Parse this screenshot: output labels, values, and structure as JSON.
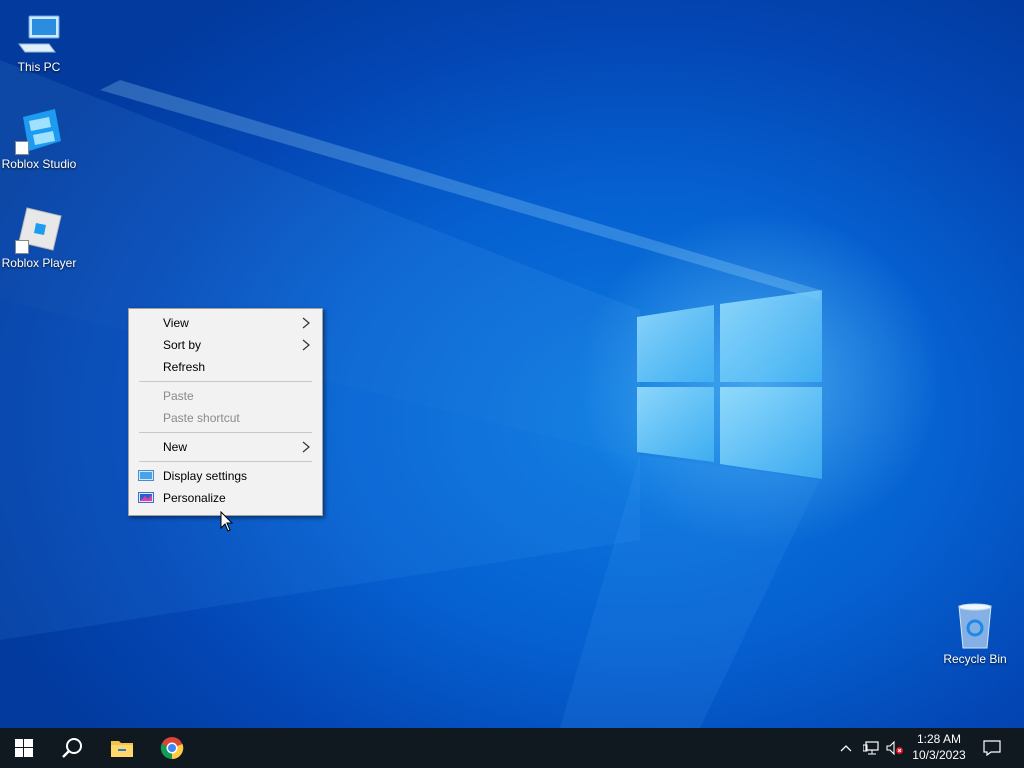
{
  "desktop": {
    "icons": [
      {
        "label": "This PC",
        "icon": "this-pc-icon"
      },
      {
        "label": "Roblox Studio",
        "icon": "roblox-studio-icon"
      },
      {
        "label": "Roblox Player",
        "icon": "roblox-player-icon"
      },
      {
        "label": "Recycle Bin",
        "icon": "recycle-bin-icon"
      }
    ]
  },
  "context_menu": {
    "items": [
      {
        "label": "View",
        "has_submenu": true,
        "enabled": true
      },
      {
        "label": "Sort by",
        "has_submenu": true,
        "enabled": true
      },
      {
        "label": "Refresh",
        "has_submenu": false,
        "enabled": true
      },
      {
        "label": "Paste",
        "has_submenu": false,
        "enabled": false
      },
      {
        "label": "Paste shortcut",
        "has_submenu": false,
        "enabled": false
      },
      {
        "label": "New",
        "has_submenu": true,
        "enabled": true
      },
      {
        "label": "Display settings",
        "icon": "display-settings-icon",
        "enabled": true
      },
      {
        "label": "Personalize",
        "icon": "personalize-icon",
        "enabled": true
      }
    ]
  },
  "taskbar": {
    "pinned": [
      "start-icon",
      "search-icon",
      "file-explorer-icon",
      "chrome-icon"
    ],
    "tray_icons": [
      "chevron-up-icon",
      "network-icon",
      "volume-muted-icon",
      "notification-icon"
    ],
    "clock": {
      "time": "1:28 AM",
      "date": "10/3/2023"
    }
  },
  "colors": {
    "taskbar": "#101820",
    "desktop_accent": "#0a7ae0",
    "menu_bg": "#f2f2f2",
    "menu_disabled_text": "#8a8a8a"
  }
}
